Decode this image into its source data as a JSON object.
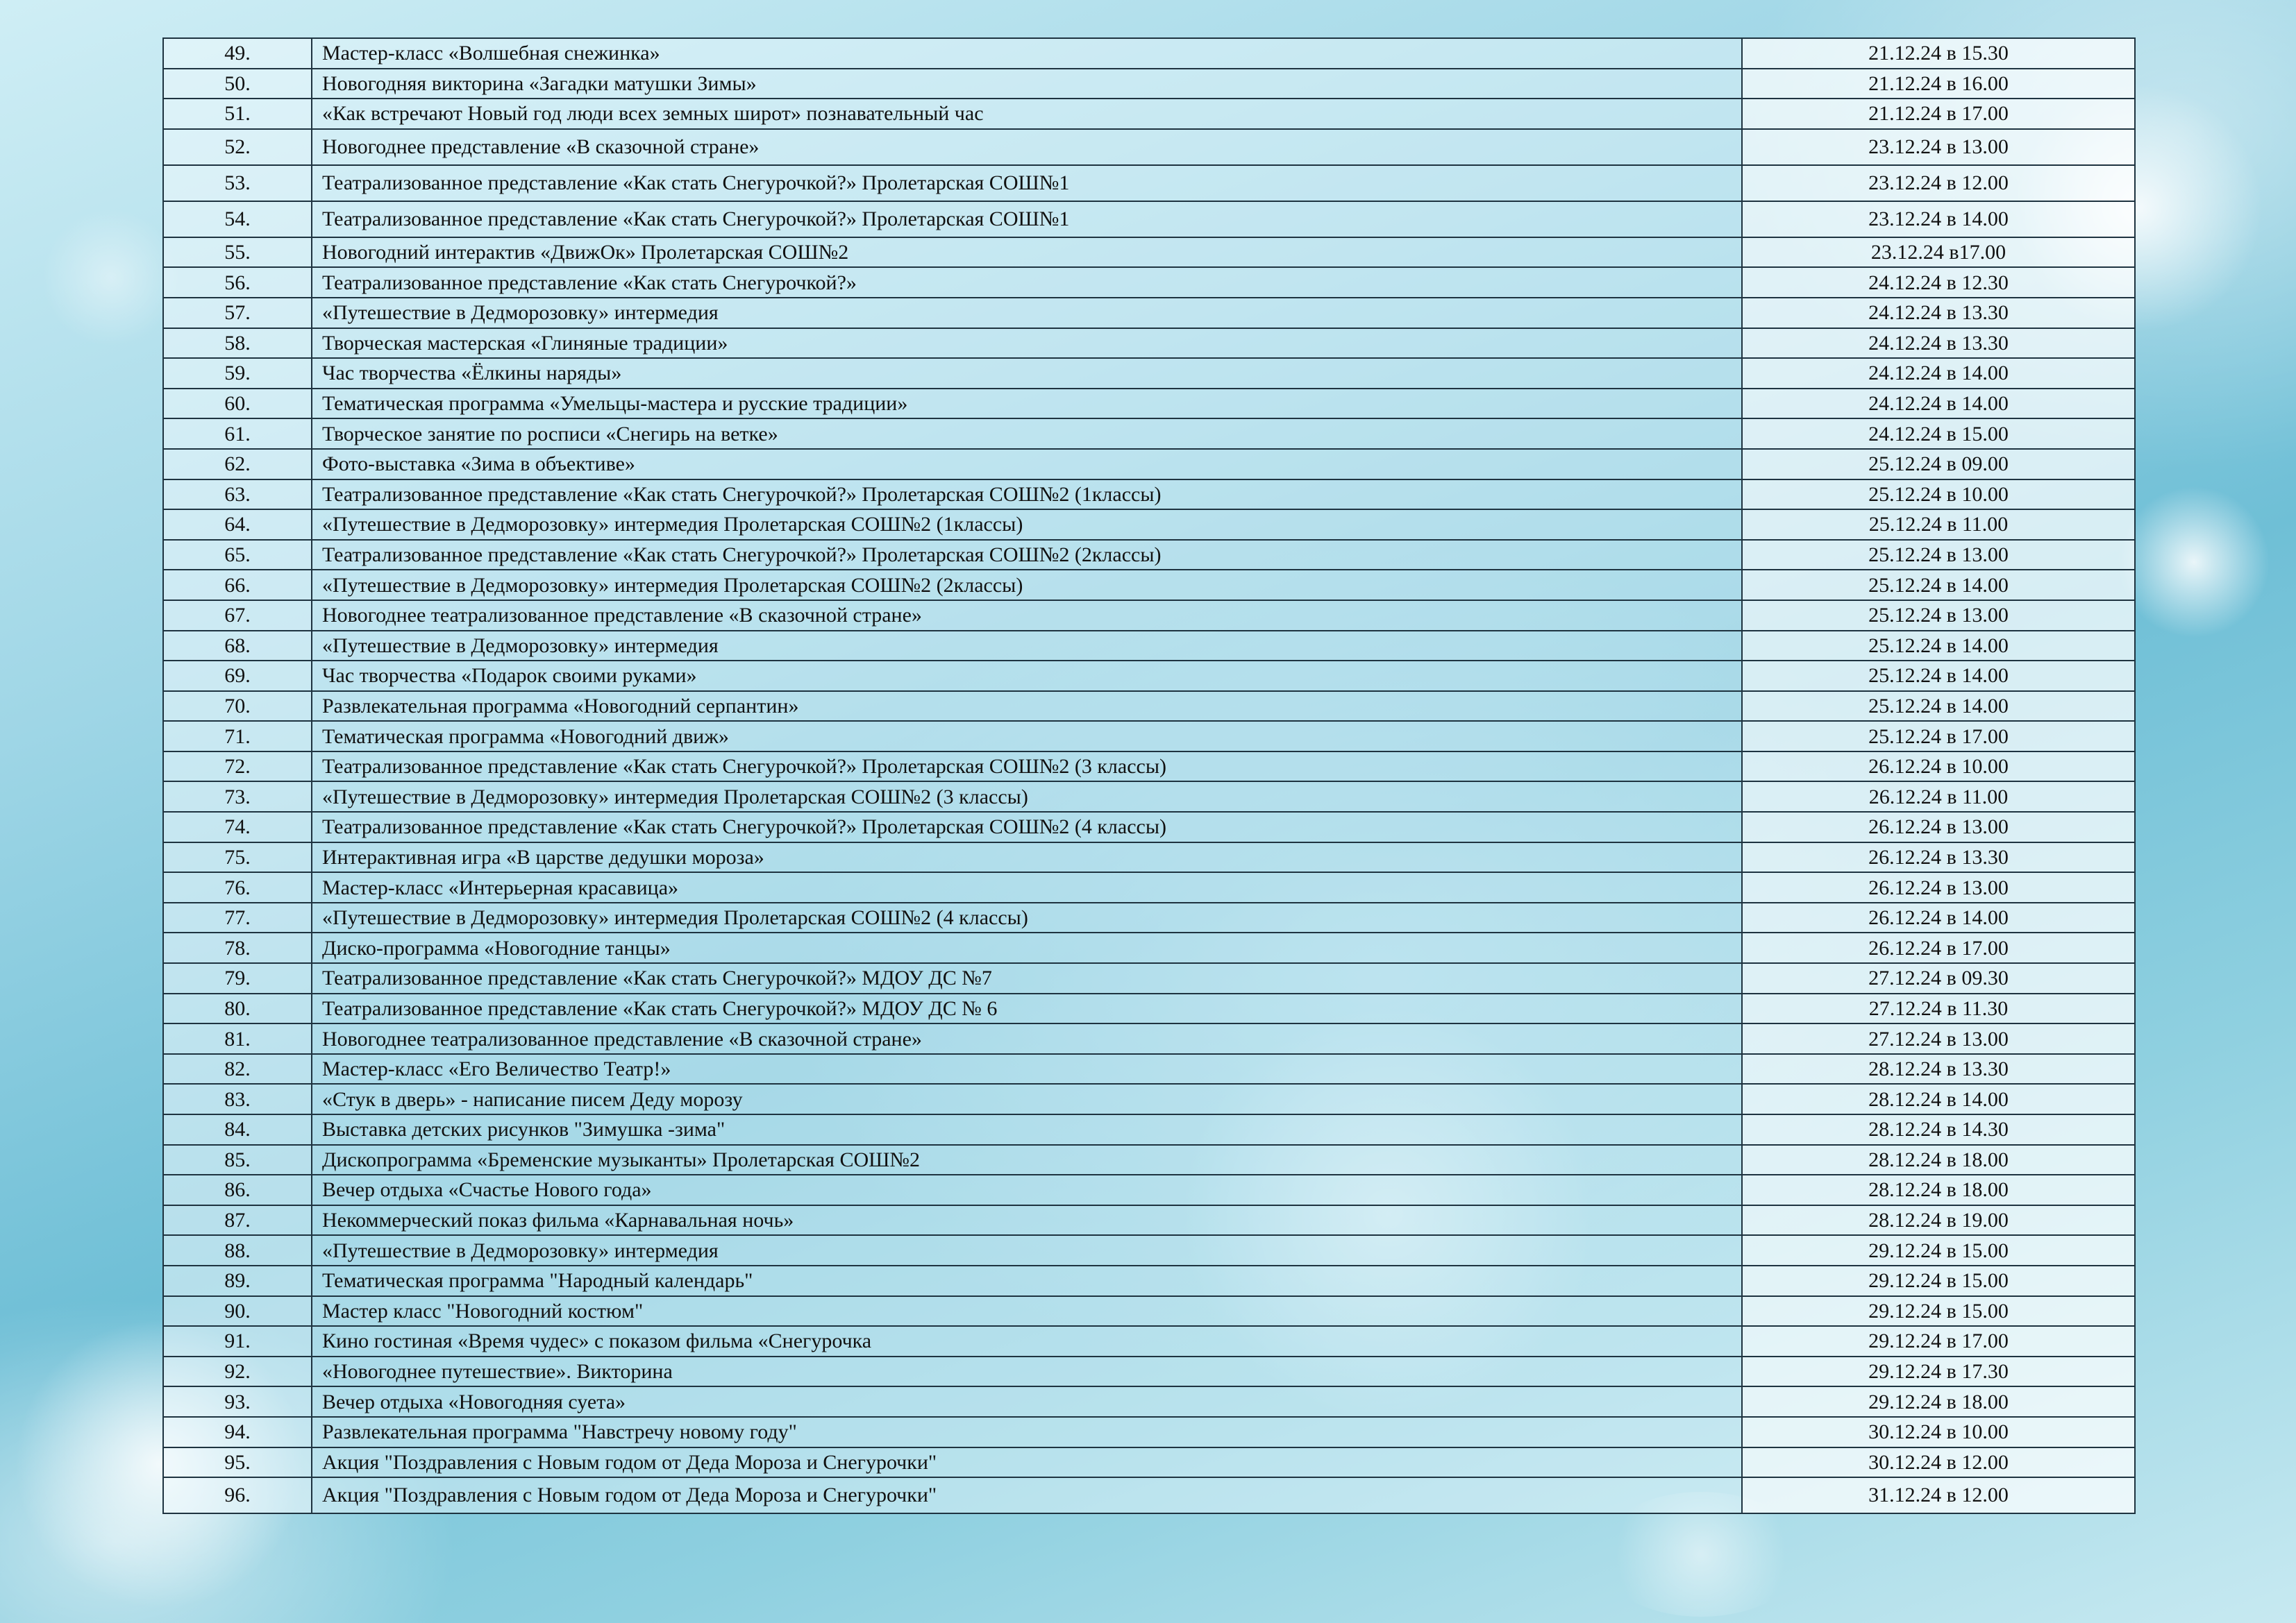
{
  "rows": [
    {
      "num": "49.",
      "title": "Мастер-класс «Волшебная снежинка»",
      "date": "21.12.24 в 15.30"
    },
    {
      "num": "50.",
      "title": "Новогодняя викторина «Загадки матушки Зимы»",
      "date": "21.12.24 в 16.00"
    },
    {
      "num": "51.",
      "title": "«Как встречают Новый год люди всех земных широт» познавательный час",
      "date": "21.12.24 в 17.00"
    },
    {
      "num": "52.",
      "title": "Новогоднее представление «В сказочной стране»",
      "date": "23.12.24 в 13.00"
    },
    {
      "num": "53.",
      "title": "Театрализованное представление «Как стать Снегурочкой?» Пролетарская СОШ№1",
      "date": "23.12.24 в 12.00"
    },
    {
      "num": "54.",
      "title": "Театрализованное представление «Как стать Снегурочкой?» Пролетарская СОШ№1",
      "date": "23.12.24 в 14.00"
    },
    {
      "num": "55.",
      "title": "Новогодний интерактив «ДвижОк» Пролетарская СОШ№2",
      "date": "23.12.24 в17.00"
    },
    {
      "num": "56.",
      "title": "Театрализованное представление «Как стать Снегурочкой?»",
      "date": "24.12.24 в 12.30"
    },
    {
      "num": "57.",
      "title": "«Путешествие в Дедморозовку» интермедия",
      "date": "24.12.24 в 13.30"
    },
    {
      "num": "58.",
      "title": "Творческая мастерская «Глиняные традиции»",
      "date": "24.12.24 в 13.30"
    },
    {
      "num": "59.",
      "title": "Час творчества «Ёлкины наряды»",
      "date": "24.12.24 в 14.00"
    },
    {
      "num": "60.",
      "title": "Тематическая программа «Умельцы-мастера и русские традиции»",
      "date": "24.12.24 в 14.00"
    },
    {
      "num": "61.",
      "title": "Творческое занятие по росписи «Снегирь на ветке»",
      "date": "24.12.24 в 15.00"
    },
    {
      "num": "62.",
      "title": "Фото-выставка «Зима в объективе»",
      "date": "25.12.24 в 09.00"
    },
    {
      "num": "63.",
      "title": "Театрализованное представление «Как стать Снегурочкой?» Пролетарская СОШ№2 (1классы)",
      "date": "25.12.24 в 10.00"
    },
    {
      "num": "64.",
      "title": "«Путешествие в Дедморозовку» интермедия Пролетарская СОШ№2 (1классы)",
      "date": "25.12.24 в 11.00"
    },
    {
      "num": "65.",
      "title": "Театрализованное представление «Как стать Снегурочкой?»  Пролетарская СОШ№2 (2классы)",
      "date": "25.12.24 в 13.00"
    },
    {
      "num": "66.",
      "title": "«Путешествие в Дедморозовку» интермедия Пролетарская СОШ№2 (2классы)",
      "date": "25.12.24 в 14.00"
    },
    {
      "num": "67.",
      "title": "Новогоднее театрализованное представление «В сказочной стране»",
      "date": "25.12.24 в 13.00"
    },
    {
      "num": "68.",
      "title": "«Путешествие в Дедморозовку» интермедия",
      "date": "25.12.24 в 14.00"
    },
    {
      "num": "69.",
      "title": "Час творчества «Подарок своими руками»",
      "date": "25.12.24 в 14.00"
    },
    {
      "num": "70.",
      "title": "Развлекательная программа «Новогодний серпантин»",
      "date": "25.12.24 в 14.00"
    },
    {
      "num": "71.",
      "title": "Тематическая программа «Новогодний движ»",
      "date": "25.12.24 в 17.00"
    },
    {
      "num": "72.",
      "title": "Театрализованное представление «Как стать Снегурочкой?» Пролетарская СОШ№2 (3 классы)",
      "date": "26.12.24 в 10.00"
    },
    {
      "num": "73.",
      "title": "«Путешествие в Дедморозовку» интермедия Пролетарская СОШ№2 (3 классы)",
      "date": "26.12.24 в 11.00"
    },
    {
      "num": "74.",
      "title": "Театрализованное представление «Как стать Снегурочкой?» Пролетарская СОШ№2 (4 классы)",
      "date": "26.12.24 в 13.00"
    },
    {
      "num": "75.",
      "title": "Интерактивная игра «В царстве дедушки мороза»",
      "date": "26.12.24 в 13.30"
    },
    {
      "num": "76.",
      "title": "Мастер-класс «Интерьерная красавица»",
      "date": "26.12.24 в 13.00"
    },
    {
      "num": "77.",
      "title": "«Путешествие в Дедморозовку» интермедия Пролетарская СОШ№2 (4 классы)",
      "date": "26.12.24 в 14.00"
    },
    {
      "num": "78.",
      "title": "Диско-программа «Новогодние танцы»",
      "date": "26.12.24 в 17.00"
    },
    {
      "num": "79.",
      "title": "Театрализованное представление «Как стать Снегурочкой?» МДОУ ДС №7",
      "date": "27.12.24 в 09.30"
    },
    {
      "num": "80.",
      "title": "Театрализованное представление «Как стать Снегурочкой?» МДОУ ДС № 6",
      "date": "27.12.24 в 11.30"
    },
    {
      "num": "81.",
      "title": "Новогоднее театрализованное представление «В сказочной стране»",
      "date": "27.12.24 в 13.00"
    },
    {
      "num": "82.",
      "title": "Мастер-класс «Его Величество Театр!»",
      "date": "28.12.24 в 13.30"
    },
    {
      "num": "83.",
      "title": "«Стук в дверь» - написание писем Деду морозу",
      "date": "28.12.24 в 14.00"
    },
    {
      "num": "84.",
      "title": "Выставка детских рисунков \"Зимушка -зима\"",
      "date": "28.12.24 в 14.30"
    },
    {
      "num": "85.",
      "title": "Дископрограмма «Бременские музыканты» Пролетарская СОШ№2",
      "date": "28.12.24 в 18.00"
    },
    {
      "num": "86.",
      "title": "Вечер отдыха «Счастье Нового года»",
      "date": "28.12.24 в 18.00"
    },
    {
      "num": "87.",
      "title": "Некоммерческий показ фильма «Карнавальная ночь»",
      "date": "28.12.24 в 19.00"
    },
    {
      "num": "88.",
      "title": "«Путешествие в Дедморозовку» интермедия",
      "date": "29.12.24 в 15.00"
    },
    {
      "num": "89.",
      "title": "Тематическая программа \"Народный календарь\"",
      "date": "29.12.24 в 15.00"
    },
    {
      "num": "90.",
      "title": "Мастер класс \"Новогодний костюм\"",
      "date": "29.12.24 в 15.00"
    },
    {
      "num": "91.",
      "title": "Кино гостиная «Время чудес» с показом фильма «Снегурочка",
      "date": "29.12.24 в 17.00"
    },
    {
      "num": "92.",
      "title": "«Новогоднее путешествие». Викторина",
      "date": "29.12.24 в 17.30"
    },
    {
      "num": "93.",
      "title": "Вечер отдыха «Новогодняя суета»",
      "date": "29.12.24 в 18.00"
    },
    {
      "num": "94.",
      "title": "Развлекательная программа \"Навстречу новому году\"",
      "date": "30.12.24 в 10.00"
    },
    {
      "num": "95.",
      "title": "Акция \"Поздравления с Новым годом от Деда Мороза и Снегурочки\"",
      "date": "30.12.24 в 12.00"
    },
    {
      "num": "96.",
      "title": "Акция \"Поздравления с Новым годом от Деда Мороза и Снегурочки\"",
      "date": "31.12.24 в 12.00"
    }
  ]
}
